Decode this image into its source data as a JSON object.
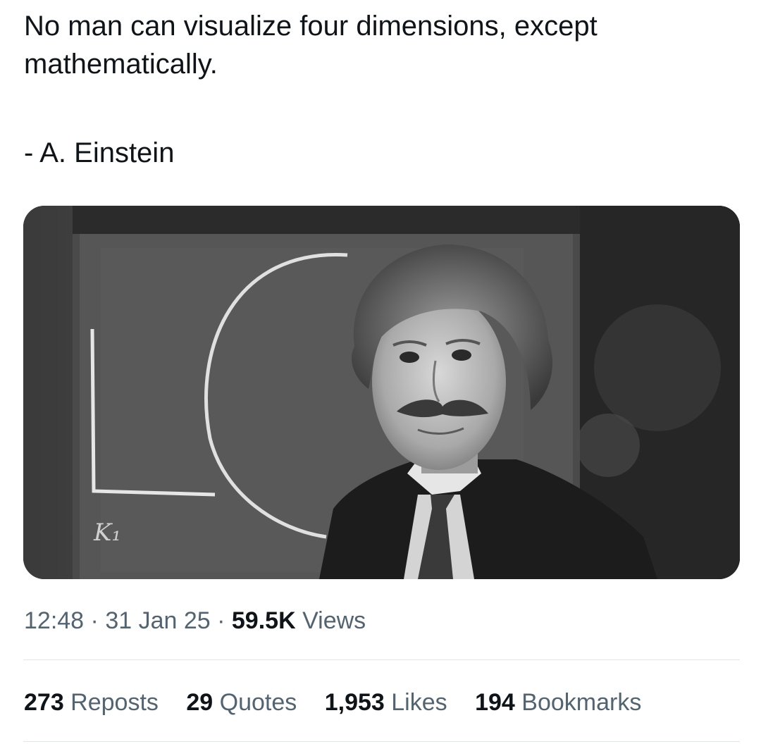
{
  "tweet": {
    "text_line1": "No man can visualize four dimensions, except",
    "text_line2": "mathematically.",
    "attribution": "- A. Einstein"
  },
  "media": {
    "description": "Black-and-white photo of Albert Einstein in front of a chalkboard",
    "chalk_label": "K₁"
  },
  "meta": {
    "time": "12:48",
    "sep1": " · ",
    "date": "31 Jan 25",
    "sep2": " · ",
    "views_count": "59.5K",
    "views_label": " Views"
  },
  "stats": [
    {
      "count": "273",
      "label": " Reposts"
    },
    {
      "count": "29",
      "label": " Quotes"
    },
    {
      "count": "1,953",
      "label": " Likes"
    },
    {
      "count": "194",
      "label": " Bookmarks"
    }
  ]
}
